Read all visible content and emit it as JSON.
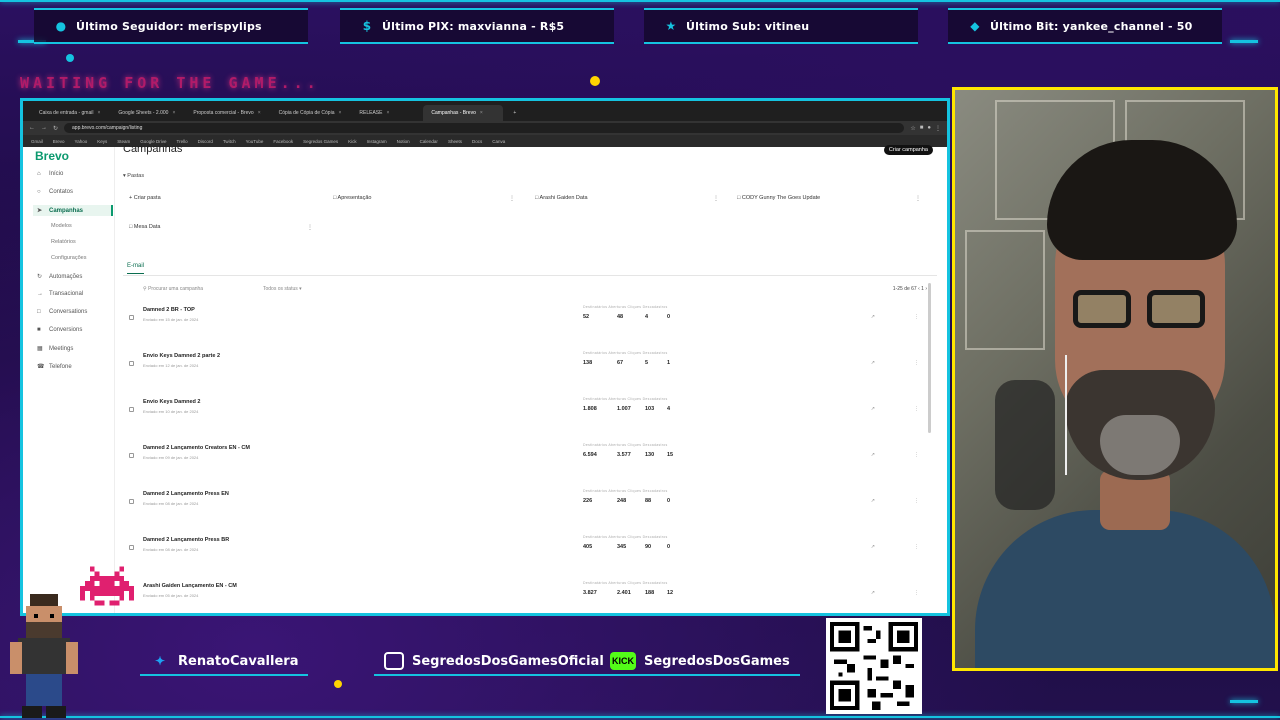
{
  "alerts": [
    {
      "icon": "user-icon",
      "text": "Último Seguidor: merispylips"
    },
    {
      "icon": "dollar-icon",
      "text": "Último PIX: maxvianna - R$5"
    },
    {
      "icon": "star-icon",
      "text": "Último Sub: vitineu"
    },
    {
      "icon": "diamond-icon",
      "text": "Último Bit: yankee_channel - 50"
    }
  ],
  "waiting_text": "WAITING FOR THE GAME...",
  "browser": {
    "tabs": [
      {
        "label": "Caixa de entrada - gmail",
        "active": false
      },
      {
        "label": "Google Sheets - 2.000",
        "active": false
      },
      {
        "label": "Proposta comercial - Brevo",
        "active": false
      },
      {
        "label": "Cópia de Cópia de Cópia",
        "active": false
      },
      {
        "label": "RELEASE",
        "active": false
      },
      {
        "label": "Campanhas - Brevo",
        "active": true
      }
    ],
    "address": "app.brevo.com/campaign/listing",
    "bookmarks": [
      "Gmail",
      "Brevo",
      "Yahoo",
      "Keys",
      "Steam",
      "Google Drive",
      "Trello",
      "Discord",
      "Twitch",
      "YouTube",
      "Facebook",
      "Segredos Games",
      "Kick",
      "Instagram",
      "Notion",
      "Calendar",
      "Sheets",
      "Docs",
      "Canva"
    ]
  },
  "app": {
    "brand": "Brevo",
    "nav": [
      {
        "label": "Início",
        "icon": "home-icon"
      },
      {
        "label": "Contatos",
        "icon": "contacts-icon"
      },
      {
        "label": "Campanhas",
        "icon": "campaign-icon",
        "active": true
      },
      {
        "label": "Automações",
        "icon": "automation-icon"
      },
      {
        "label": "Transacional",
        "icon": "transactional-icon"
      },
      {
        "label": "Conversations",
        "icon": "chat-icon"
      },
      {
        "label": "Conversions",
        "icon": "conversions-icon"
      },
      {
        "label": "Meetings",
        "icon": "calendar-icon"
      },
      {
        "label": "Telefone",
        "icon": "phone-icon"
      }
    ],
    "subnav": [
      "Modelos",
      "Relatórios",
      "Configurações"
    ],
    "page_title": "Campanhas",
    "create_button": "Criar campanha",
    "folders_label": "Pastas",
    "create_folder": "+ Criar pasta",
    "folders": [
      "Apresentação",
      "Arashi Gaiden Data",
      "CODY Gunny The Goes Update",
      "Mesa Data"
    ],
    "tab_email": "E-mail",
    "search_placeholder": "Procurar uma campanha",
    "filter_label": "Todos os status",
    "pager": "1-25 de 67",
    "stat_headers": "Destinatários   Aberturas   Cliques   Descadastros",
    "campaigns": [
      {
        "name": "Damned 2 BR - TOP",
        "meta": "Enviado em 15 de jan. de 2024",
        "s1": "52",
        "s2": "48",
        "s3": "4",
        "s4": "0"
      },
      {
        "name": "Envio Keys Damned 2 parte 2",
        "meta": "Enviado em 12 de jan. de 2024",
        "s1": "138",
        "s2": "67",
        "s3": "5",
        "s4": "1"
      },
      {
        "name": "Envio Keys Damned 2",
        "meta": "Enviado em 10 de jan. de 2024",
        "s1": "1.808",
        "s2": "1.007",
        "s3": "103",
        "s4": "4"
      },
      {
        "name": "Damned 2 Lançamento Creators EN - CM",
        "meta": "Enviado em 09 de jan. de 2024",
        "s1": "6.594",
        "s2": "3.577",
        "s3": "130",
        "s4": "15"
      },
      {
        "name": "Damned 2 Lançamento Press EN",
        "meta": "Enviado em 08 de jan. de 2024",
        "s1": "226",
        "s2": "248",
        "s3": "88",
        "s4": "0"
      },
      {
        "name": "Damned 2 Lançamento Press BR",
        "meta": "Enviado em 08 de jan. de 2024",
        "s1": "405",
        "s2": "345",
        "s3": "90",
        "s4": "0"
      },
      {
        "name": "Arashi Gaiden Lançamento EN - CM",
        "meta": "Enviado em 05 de jan. de 2024",
        "s1": "3.827",
        "s2": "2.401",
        "s3": "188",
        "s4": "12"
      }
    ]
  },
  "socials": [
    {
      "icon": "twitter-icon",
      "handle": "RenatoCavallera"
    },
    {
      "icon": "instagram-icon",
      "handle": "SegredosDosGamesOficial"
    },
    {
      "icon": "kick-icon",
      "icon_text": "KICK",
      "handle": "SegredosDosGames"
    }
  ],
  "qr_url": "livepix.gg/segredosdosgames",
  "colors": {
    "accent": "#15c3e0",
    "cam_border": "#ffe600",
    "brevo": "#0b996e",
    "background": "#1b0d3a"
  }
}
